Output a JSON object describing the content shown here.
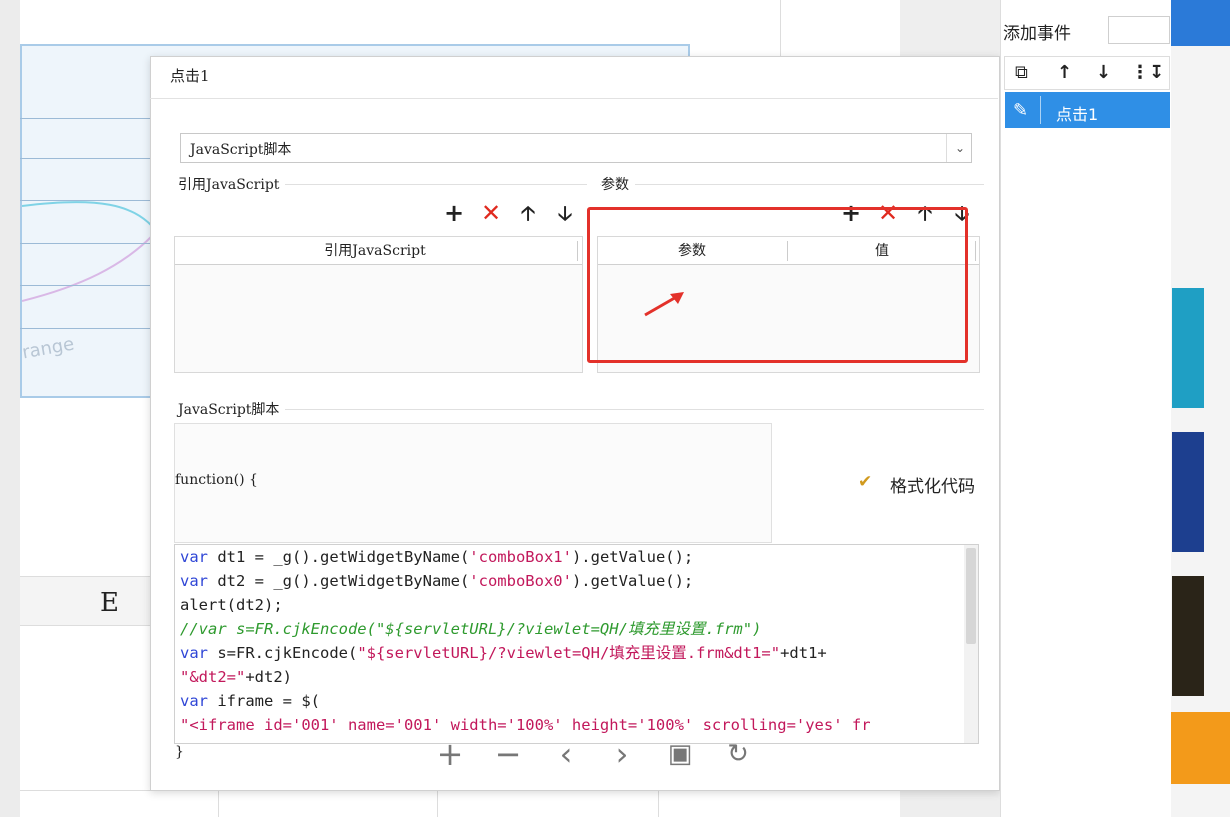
{
  "dialog": {
    "title": "点击1",
    "script_type": "JavaScript脚本",
    "ref_js_group": "引用JavaScript",
    "ref_js_column": "引用JavaScript",
    "params_group": "参数",
    "params_columns": [
      "参数",
      "值"
    ],
    "script_group": "JavaScript脚本",
    "function_header": "function() {",
    "function_footer": "}",
    "format_code_label": "格式化代码"
  },
  "code": {
    "line1": [
      "var",
      " dt1 = _g().getWidgetByName(",
      "'comboBox1'",
      ").getValue();"
    ],
    "line2": [
      "var",
      " dt2 = _g().getWidgetByName(",
      "'comboBox0'",
      ").getValue();"
    ],
    "line3": "alert(dt2);",
    "line4": "//var s=FR.cjkEncode(\"${servletURL}/?viewlet=QH/填充里设置.frm\")",
    "line5": [
      "var",
      " s=FR.cjkEncode(",
      "\"${servletURL}/?viewlet=QH/填充里设置.frm&dt1=\"",
      "+dt1+"
    ],
    "line6": [
      "\"&dt2=\"",
      "+dt2)"
    ],
    "line7": [
      "var",
      " iframe = $("
    ],
    "line8": "\"<iframe id='001' name='001' width='100%' height='100%' scrolling='yes' fr"
  },
  "right_panel": {
    "add_event_label": "添加事件",
    "event_items": [
      "点击1"
    ]
  },
  "background": {
    "letter": "E",
    "chart_word": "range"
  },
  "icons": {
    "ref_toolbar": [
      "plus-icon",
      "close-icon",
      "arrow-up-icon",
      "arrow-down-icon"
    ],
    "param_toolbar": [
      "plus-icon",
      "close-icon",
      "arrow-up-icon",
      "arrow-down-icon"
    ],
    "event_toolbar": [
      "copy-icon",
      "arrow-up-icon",
      "arrow-down-icon",
      "move-to-bottom-icon"
    ],
    "bottom_toolbar": [
      "zoom-in-icon",
      "zoom-out-icon",
      "previous-icon",
      "next-icon",
      "fit-icon",
      "rotate-icon"
    ]
  },
  "colors": {
    "accent": "#2f8fe6",
    "highlight": "#e3312a",
    "keyword": "#2f46d6",
    "string": "#c2185b",
    "comment": "#2e9a2e"
  }
}
